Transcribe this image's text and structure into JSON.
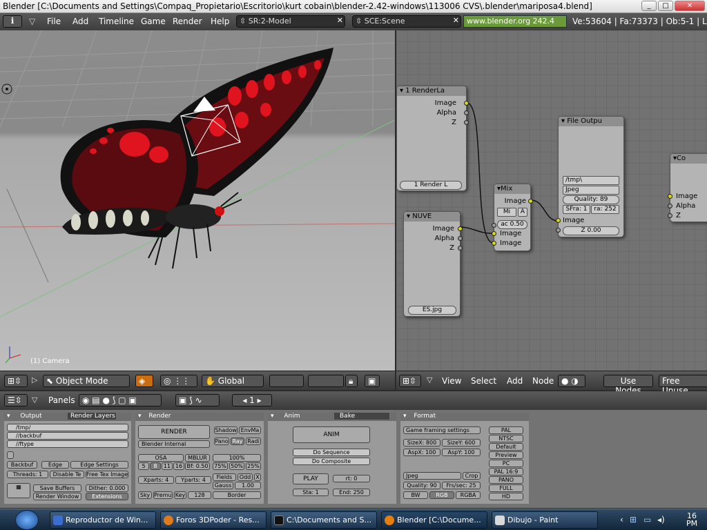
{
  "window": {
    "title": "Blender [C:\\Documents and Settings\\Compaq_Propietario\\Escritorio\\kurt cobain\\blender-2.42-windows\\113006 CVS\\.blender\\mariposa4.blend]"
  },
  "topbar": {
    "menus": [
      "File",
      "Add",
      "Timeline",
      "Game",
      "Render",
      "Help"
    ],
    "screen": "SR:2-Model",
    "scene": "SCE:Scene",
    "link": "www.blender.org 242.4",
    "stats": "Ve:53604 | Fa:73373 | Ob:5-1 | L"
  },
  "viewport": {
    "object_label": "(1) Camera"
  },
  "view3d_header": {
    "mode": "Object Mode",
    "orientation": "Global"
  },
  "node_header": {
    "menus": [
      "View",
      "Select",
      "Add",
      "Node"
    ],
    "use_nodes": "Use Nodes",
    "free_unused": "Free Unuse"
  },
  "nodes": {
    "render_layers": {
      "title": "1 RenderLa",
      "outputs": [
        "Image",
        "Alpha",
        "Z"
      ],
      "layer": "1 Render L"
    },
    "nuve": {
      "title": "NUVE",
      "outputs": [
        "Image",
        "Alpha",
        "Z"
      ],
      "file": "ES.jpg"
    },
    "mix": {
      "title": "Mix",
      "mode": "Mi",
      "fac": "ac 0.50",
      "inputs": [
        "Image",
        "Image"
      ],
      "out": "Image"
    },
    "file_output": {
      "title": "File Outpu",
      "path": "/tmp\\",
      "format": "Jpeg",
      "quality": "Quality: 89",
      "sfra": "SFra: 1",
      "efra": "ra: 252",
      "input": "Image",
      "z": "Z 0.00"
    },
    "composite": {
      "title": "Co",
      "inputs": [
        "Image",
        "Alpha",
        "Z"
      ]
    }
  },
  "buttons_header": {
    "panels": "Panels",
    "frame": "1"
  },
  "output_panel": {
    "tabs": [
      "Output",
      "Render Layers"
    ],
    "paths": [
      "/tmp/",
      "//backbuf",
      "//ftype"
    ],
    "buttons": [
      "Backbuf",
      "Edge",
      "Edge Settings",
      "Threads: 1",
      "Disable Te",
      "Free Tex Image",
      "Save Buffers",
      "Dither: 0.000",
      "Render Window",
      "Extensions"
    ]
  },
  "render_panel": {
    "title": "Render",
    "render": "RENDER",
    "engine": "Blender Internal",
    "buttons": [
      "Shadow",
      "EnvMa",
      "Pano",
      "Ray",
      "Radi",
      "OSA",
      "MBLUR",
      "100%",
      "5",
      "8",
      "11",
      "16",
      "Bf: 0.50",
      "75%",
      "50%",
      "25%",
      "Xparts: 4",
      "Yparts: 4",
      "Fields",
      "Odd",
      "X",
      "Gauss",
      "1.00",
      "Sky",
      "Premul",
      "Key",
      "128",
      "Border"
    ]
  },
  "anim_panel": {
    "tabs": [
      "Anim",
      "Bake"
    ],
    "anim": "ANIM",
    "seq": "Do Sequence",
    "comp": "Do Composite",
    "play": "PLAY",
    "rt": "rt: 0",
    "sta": "Sta: 1",
    "end": "End: 250"
  },
  "format_panel": {
    "title": "Format",
    "preset_menu": "Game framing settings",
    "sizex": "SizeX: 800",
    "sizey": "SizeY: 600",
    "aspx": "AspX: 100",
    "aspy": "AspY: 100",
    "presets": [
      "PAL",
      "NTSC",
      "Default",
      "Preview",
      "PC",
      "PAL 16:9",
      "PANO",
      "FULL",
      "HD"
    ],
    "format": "Jpeg",
    "crop": "Crop",
    "quality": "Quality: 90",
    "fps": "Frs/sec: 25",
    "bw": "BW",
    "rgb": "RGB",
    "rgba": "RGBA"
  },
  "taskbar": {
    "tasks": [
      "Reproductor de Win...",
      "Foros 3DPoder - Res...",
      "C:\\Documents and S...",
      "Blender [C:\\Docume...",
      "Dibujo - Paint"
    ],
    "clock": "16\nPM"
  },
  "colors": {
    "accent": "#6a9a3a",
    "butterfly": "#e0141e"
  }
}
